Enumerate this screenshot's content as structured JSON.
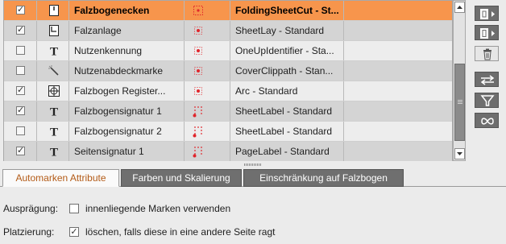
{
  "table": {
    "rows": [
      {
        "checked": true,
        "icon": "fold-cut-mark-icon",
        "name": "Falzbogenecken",
        "mark_icon": "marker-box-icon",
        "template": "FoldingSheetCut - St...",
        "selected": true
      },
      {
        "checked": true,
        "icon": "sheet-lay-icon",
        "name": "Falzanlage",
        "mark_icon": "marker-dot-icon",
        "template": "SheetLay - Standard",
        "selected": false
      },
      {
        "checked": false,
        "icon": "text-t-icon",
        "name": "Nutzenkennung",
        "mark_icon": "marker-dot-icon",
        "template": "OneUpIdentifier - Sta...",
        "selected": false
      },
      {
        "checked": false,
        "icon": "wand-icon",
        "name": "Nutzenabdeckmarke",
        "mark_icon": "marker-dot-icon",
        "template": "CoverClippath - Stan...",
        "selected": false
      },
      {
        "checked": true,
        "icon": "registration-mark-icon",
        "name": "Falzbogen Register...",
        "mark_icon": "marker-dot-icon",
        "template": "Arc - Standard",
        "selected": false
      },
      {
        "checked": true,
        "icon": "text-t-icon",
        "name": "Falzbogensignatur 1",
        "mark_icon": "marker-grid-icon",
        "template": "SheetLabel - Standard",
        "selected": false
      },
      {
        "checked": false,
        "icon": "text-t-icon",
        "name": "Falzbogensignatur 2",
        "mark_icon": "marker-grid-icon",
        "template": "SheetLabel - Standard",
        "selected": false
      },
      {
        "checked": true,
        "icon": "text-t-icon",
        "name": "Seitensignatur 1",
        "mark_icon": "marker-grid-icon",
        "template": "PageLabel - Standard",
        "selected": false
      }
    ],
    "check_glyph": "✓"
  },
  "side_buttons": [
    {
      "name": "mark-sheet-button",
      "icon": "sheet-arrow-icon"
    },
    {
      "name": "mark-page-button",
      "icon": "page-arrow-icon"
    },
    {
      "name": "delete-button",
      "icon": "trash-icon"
    },
    {
      "name": "swap-button",
      "icon": "swap-arrows-icon"
    },
    {
      "name": "filter-button",
      "icon": "filter-icon"
    },
    {
      "name": "link-button",
      "icon": "infinity-icon"
    }
  ],
  "tabs": [
    {
      "label": "Automarken Attribute",
      "active": true
    },
    {
      "label": "Farben und Skalierung",
      "active": false
    },
    {
      "label": "Einschränkung auf Falzbogen",
      "active": false
    }
  ],
  "form": {
    "auspraegung_label": "Ausprägung:",
    "inner_marks_label": "innenliegende Marken verwenden",
    "inner_marks_checked": false,
    "platzierung_label": "Platzierung:",
    "delete_label": "löschen, falls diese in eine andere Seite ragt",
    "delete_checked": true
  },
  "colors": {
    "selection": "#f7954c",
    "active_tab_text": "#b35b17",
    "marker_red": "#e0262c"
  }
}
